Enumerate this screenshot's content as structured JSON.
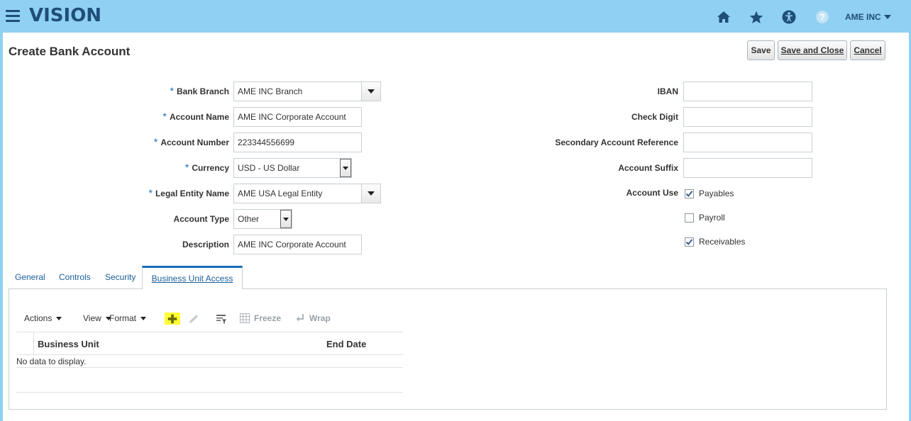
{
  "header": {
    "logo": "VISION",
    "user": "AME INC"
  },
  "page": {
    "title": "Create Bank Account",
    "buttons": {
      "save": "Save",
      "save_close": "Save and Close",
      "cancel": "Cancel"
    }
  },
  "form_left": {
    "bank_branch": {
      "label": "Bank Branch",
      "value": "AME INC Branch",
      "required": true
    },
    "account_name": {
      "label": "Account Name",
      "value": "AME INC Corporate Account",
      "required": true
    },
    "account_number": {
      "label": "Account Number",
      "value": "223344556699",
      "required": true
    },
    "currency": {
      "label": "Currency",
      "value": "USD - US Dollar",
      "required": true
    },
    "legal_entity": {
      "label": "Legal Entity Name",
      "value": "AME USA Legal Entity",
      "required": true
    },
    "account_type": {
      "label": "Account Type",
      "value": "Other"
    },
    "description": {
      "label": "Description",
      "value": "AME INC Corporate Account"
    }
  },
  "form_right": {
    "iban": {
      "label": "IBAN",
      "value": ""
    },
    "check_digit": {
      "label": "Check Digit",
      "value": ""
    },
    "secondary_ref": {
      "label": "Secondary Account Reference",
      "value": ""
    },
    "account_suffix": {
      "label": "Account Suffix",
      "value": ""
    },
    "account_use": {
      "label": "Account Use",
      "options": [
        {
          "label": "Payables",
          "checked": true
        },
        {
          "label": "Payroll",
          "checked": false
        },
        {
          "label": "Receivables",
          "checked": true
        }
      ]
    }
  },
  "tabs": [
    {
      "label": "General",
      "active": false
    },
    {
      "label": "Controls",
      "active": false
    },
    {
      "label": "Security",
      "active": false
    },
    {
      "label": "Business Unit Access",
      "active": true
    }
  ],
  "toolbar": {
    "actions": "Actions",
    "view": "View",
    "format": "Format",
    "freeze": "Freeze",
    "wrap": "Wrap"
  },
  "table": {
    "columns": [
      "Business Unit",
      "End Date"
    ],
    "empty_text": "No data to display."
  },
  "colors": {
    "header_bg": "#8fd0f3",
    "brand": "#1f4e79",
    "link": "#1a5e9a",
    "required": "#1a6dbd",
    "highlight": "#ffff33"
  }
}
